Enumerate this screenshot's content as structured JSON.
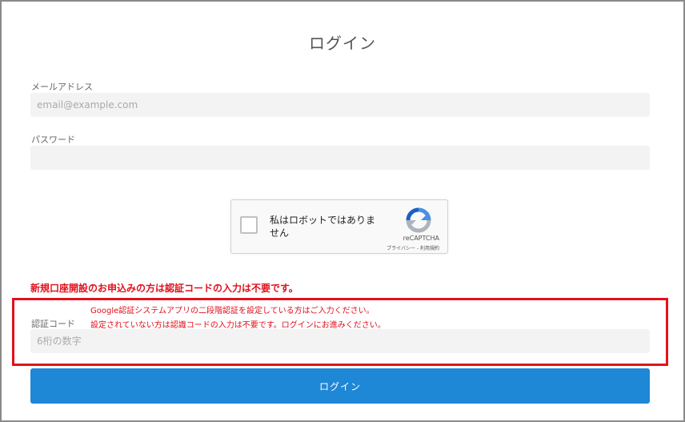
{
  "title": "ログイン",
  "email": {
    "label": "メールアドレス",
    "value": "",
    "placeholder": "email@example.com"
  },
  "password": {
    "label": "パスワード",
    "value": "",
    "placeholder": ""
  },
  "recaptcha": {
    "checkbox_label": "私はロボットではありません",
    "brand": "reCAPTCHA",
    "privacy": "プライバシー",
    "separator": " - ",
    "terms": "利用規約",
    "checked": false
  },
  "notice": "新規口座開設のお申込みの方は認証コードの入力は不要です。",
  "code": {
    "note_line1": "Google認証システムアプリの二段階認証を設定している方はご入力ください。",
    "note_line2": "設定されていない方は認識コードの入力は不要です。ログインにお進みください。",
    "label": "認証コード",
    "value": "",
    "placeholder": "6桁の数字"
  },
  "submit_label": "ログイン",
  "colors": {
    "accent": "#1e87d6",
    "alert": "#e3111e",
    "input_bg": "#f3f3f3"
  }
}
